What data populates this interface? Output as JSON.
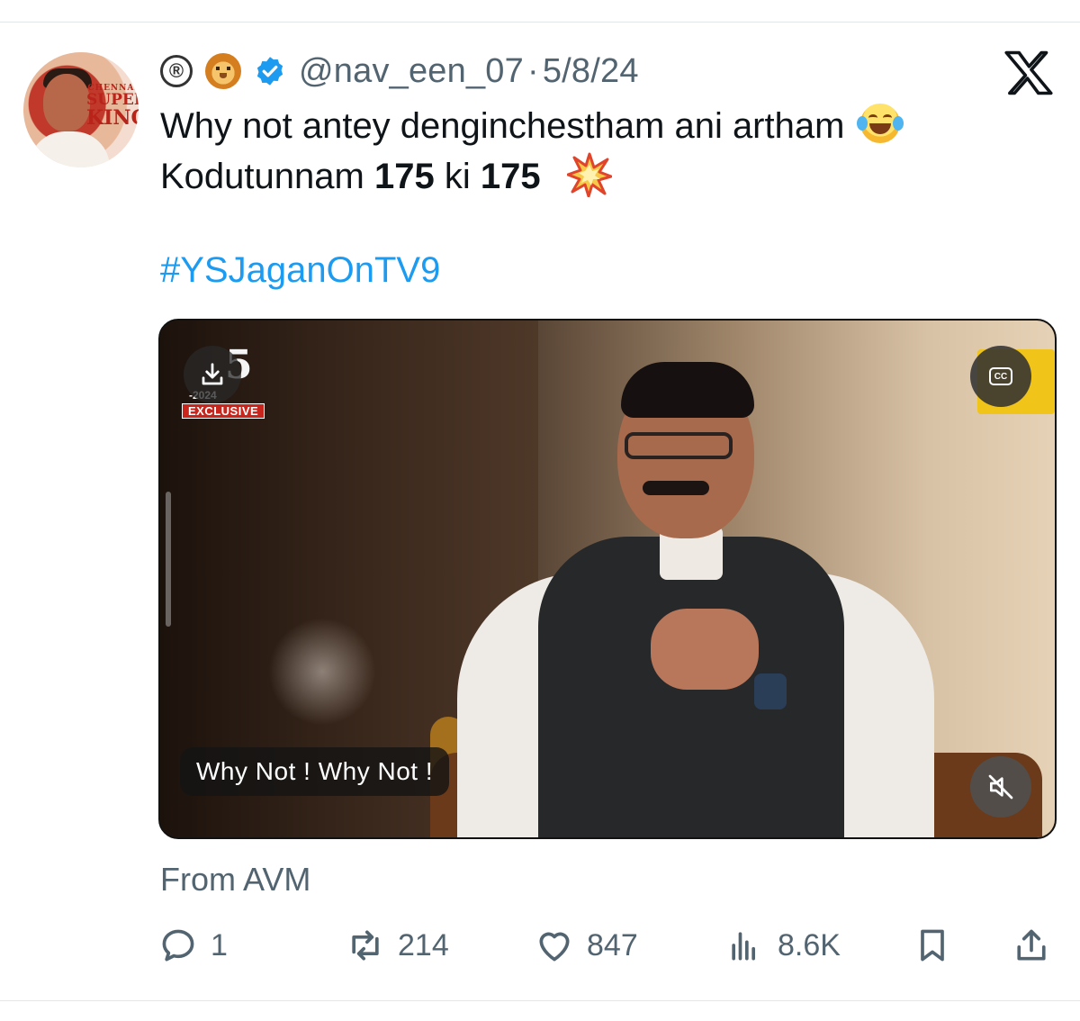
{
  "tweet": {
    "handle": "@nav_een_07",
    "separator": "·",
    "date": "5/8/24",
    "text_line1": "Why not antey denginchestham ani artham",
    "text_line2_part1": "Kodutunnam ",
    "text_line2_bold1": "175",
    "text_line2_part2": " ki ",
    "text_line2_bold2": "175",
    "hashtag": "#YSJaganOnTV9",
    "source": "From AVM"
  },
  "avatar": {
    "csk_line1": "CHENNAI",
    "csk_line2": "SUPER",
    "csk_line3": "KINGS"
  },
  "header_icons": {
    "registered_glyph": "®",
    "icons": [
      "registered-icon",
      "lion-face-icon",
      "verified-badge-icon"
    ]
  },
  "media": {
    "logo_number": "5",
    "logo_year": "-2024",
    "logo_tag": "EXCLUSIVE",
    "caption": "Why Not ! Why Not !",
    "cc_label": "CC"
  },
  "actions": {
    "replies": "1",
    "reposts": "214",
    "likes": "847",
    "views": "8.6K"
  },
  "colors": {
    "accent": "#1d9bf0",
    "secondary_text": "#536471",
    "primary_text": "#0f1419"
  }
}
